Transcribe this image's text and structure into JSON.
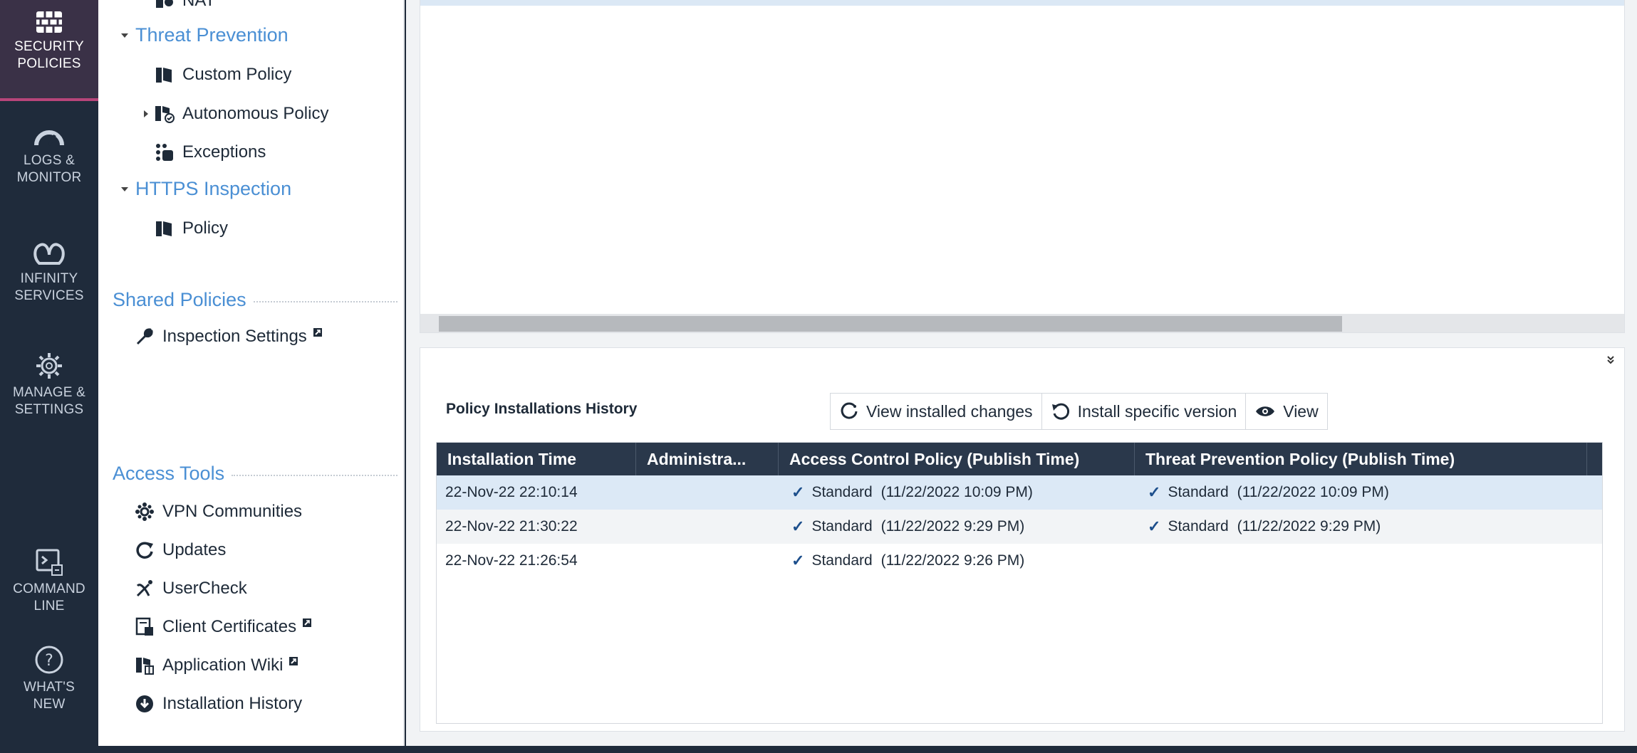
{
  "rail": {
    "items": [
      {
        "label": "SECURITY\nPOLICIES",
        "icon": "firewall-grid-icon",
        "active": true
      },
      {
        "label": "LOGS &\nMONITOR",
        "icon": "gauge-icon"
      },
      {
        "label": "INFINITY\nSERVICES",
        "icon": "infinity-icon"
      },
      {
        "label": "MANAGE &\nSETTINGS",
        "icon": "gear-icon"
      },
      {
        "label": "COMMAND\nLINE",
        "icon": "terminal-icon"
      },
      {
        "label": "WHAT'S\nNEW",
        "icon": "question-icon"
      }
    ]
  },
  "sidebar": {
    "nat_label": "NAT",
    "threat_prevention": {
      "label": "Threat Prevention",
      "items": [
        {
          "label": "Custom Policy",
          "icon": "policy-book-icon"
        },
        {
          "label": "Autonomous Policy",
          "icon": "autonomous-policy-icon"
        },
        {
          "label": "Exceptions",
          "icon": "exceptions-icon"
        }
      ]
    },
    "https_inspection": {
      "label": "HTTPS Inspection",
      "items": [
        {
          "label": "Policy",
          "icon": "policy-book-icon"
        }
      ]
    },
    "shared_policies": {
      "label": "Shared Policies",
      "items": [
        {
          "label": "Inspection Settings",
          "icon": "wrench-icon"
        }
      ]
    },
    "access_tools": {
      "label": "Access Tools",
      "items": [
        {
          "label": "VPN Communities",
          "icon": "vpn-communities-icon"
        },
        {
          "label": "Updates",
          "icon": "updates-icon"
        },
        {
          "label": "UserCheck",
          "icon": "usercheck-icon"
        },
        {
          "label": "Client Certificates",
          "icon": "client-certificates-icon"
        },
        {
          "label": "Application Wiki",
          "icon": "application-wiki-icon"
        },
        {
          "label": "Installation History",
          "icon": "installation-history-icon"
        }
      ]
    }
  },
  "history": {
    "title": "Policy Installations History",
    "toolbar": {
      "view_changes": "View installed changes",
      "install_version": "Install specific version",
      "view": "View"
    },
    "columns": [
      "Installation Time",
      "Administra...",
      "Access Control Policy (Publish Time)",
      "Threat Prevention Policy (Publish Time)"
    ],
    "rows": [
      {
        "time": "22-Nov-22 22:10:14",
        "admin": "",
        "access_name": "Standard",
        "access_time": "(11/22/2022 10:09 PM)",
        "threat_name": "Standard",
        "threat_time": "(11/22/2022 10:09 PM)"
      },
      {
        "time": "22-Nov-22 21:30:22",
        "admin": "",
        "access_name": "Standard",
        "access_time": "(11/22/2022 9:29 PM)",
        "threat_name": "Standard",
        "threat_time": "(11/22/2022 9:29 PM)"
      },
      {
        "time": "22-Nov-22 21:26:54",
        "admin": "",
        "access_name": "Standard",
        "access_time": "(11/22/2022 9:26 PM)",
        "threat_name": "",
        "threat_time": ""
      }
    ]
  },
  "colors": {
    "rail_bg": "#1f2b3b",
    "accent_active": "#b8457a",
    "link_blue": "#4a8fd4",
    "header_bg": "#2a384b",
    "selected_row": "#dce9f6"
  }
}
